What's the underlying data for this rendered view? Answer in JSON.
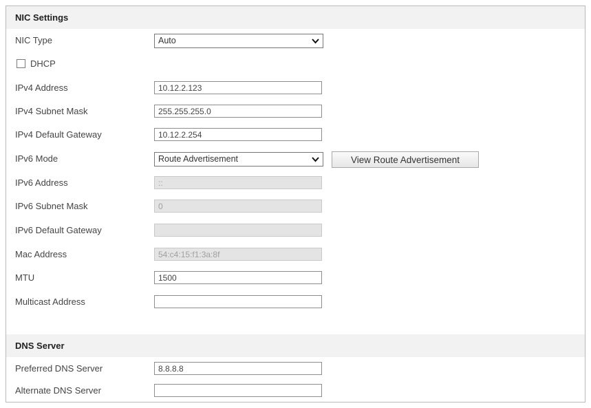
{
  "nic_settings": {
    "title": "NIC Settings",
    "nic_type": {
      "label": "NIC Type",
      "value": "Auto"
    },
    "dhcp": {
      "label": "DHCP",
      "checked": false
    },
    "ipv4_address": {
      "label": "IPv4 Address",
      "value": "10.12.2.123"
    },
    "ipv4_subnet_mask": {
      "label": "IPv4 Subnet Mask",
      "value": "255.255.255.0"
    },
    "ipv4_default_gateway": {
      "label": "IPv4 Default Gateway",
      "value": "10.12.2.254"
    },
    "ipv6_mode": {
      "label": "IPv6 Mode",
      "value": "Route Advertisement",
      "button_label": "View Route Advertisement"
    },
    "ipv6_address": {
      "label": "IPv6 Address",
      "value": "::"
    },
    "ipv6_subnet_mask": {
      "label": "IPv6 Subnet Mask",
      "value": "0"
    },
    "ipv6_default_gateway": {
      "label": "IPv6 Default Gateway",
      "value": ""
    },
    "mac_address": {
      "label": "Mac Address",
      "value": "54:c4:15:f1:3a:8f"
    },
    "mtu": {
      "label": "MTU",
      "value": "1500"
    },
    "multicast_address": {
      "label": "Multicast Address",
      "value": ""
    }
  },
  "dns_server": {
    "title": "DNS Server",
    "preferred": {
      "label": "Preferred DNS Server",
      "value": "8.8.8.8"
    },
    "alternate": {
      "label": "Alternate DNS Server",
      "value": ""
    }
  },
  "colors": {
    "header_bg": "#f2f2f2",
    "border": "#b9b9b9",
    "disabled_field_bg": "#e4e4e4"
  },
  "icons": {
    "select_arrow": "chevron-down-icon"
  }
}
